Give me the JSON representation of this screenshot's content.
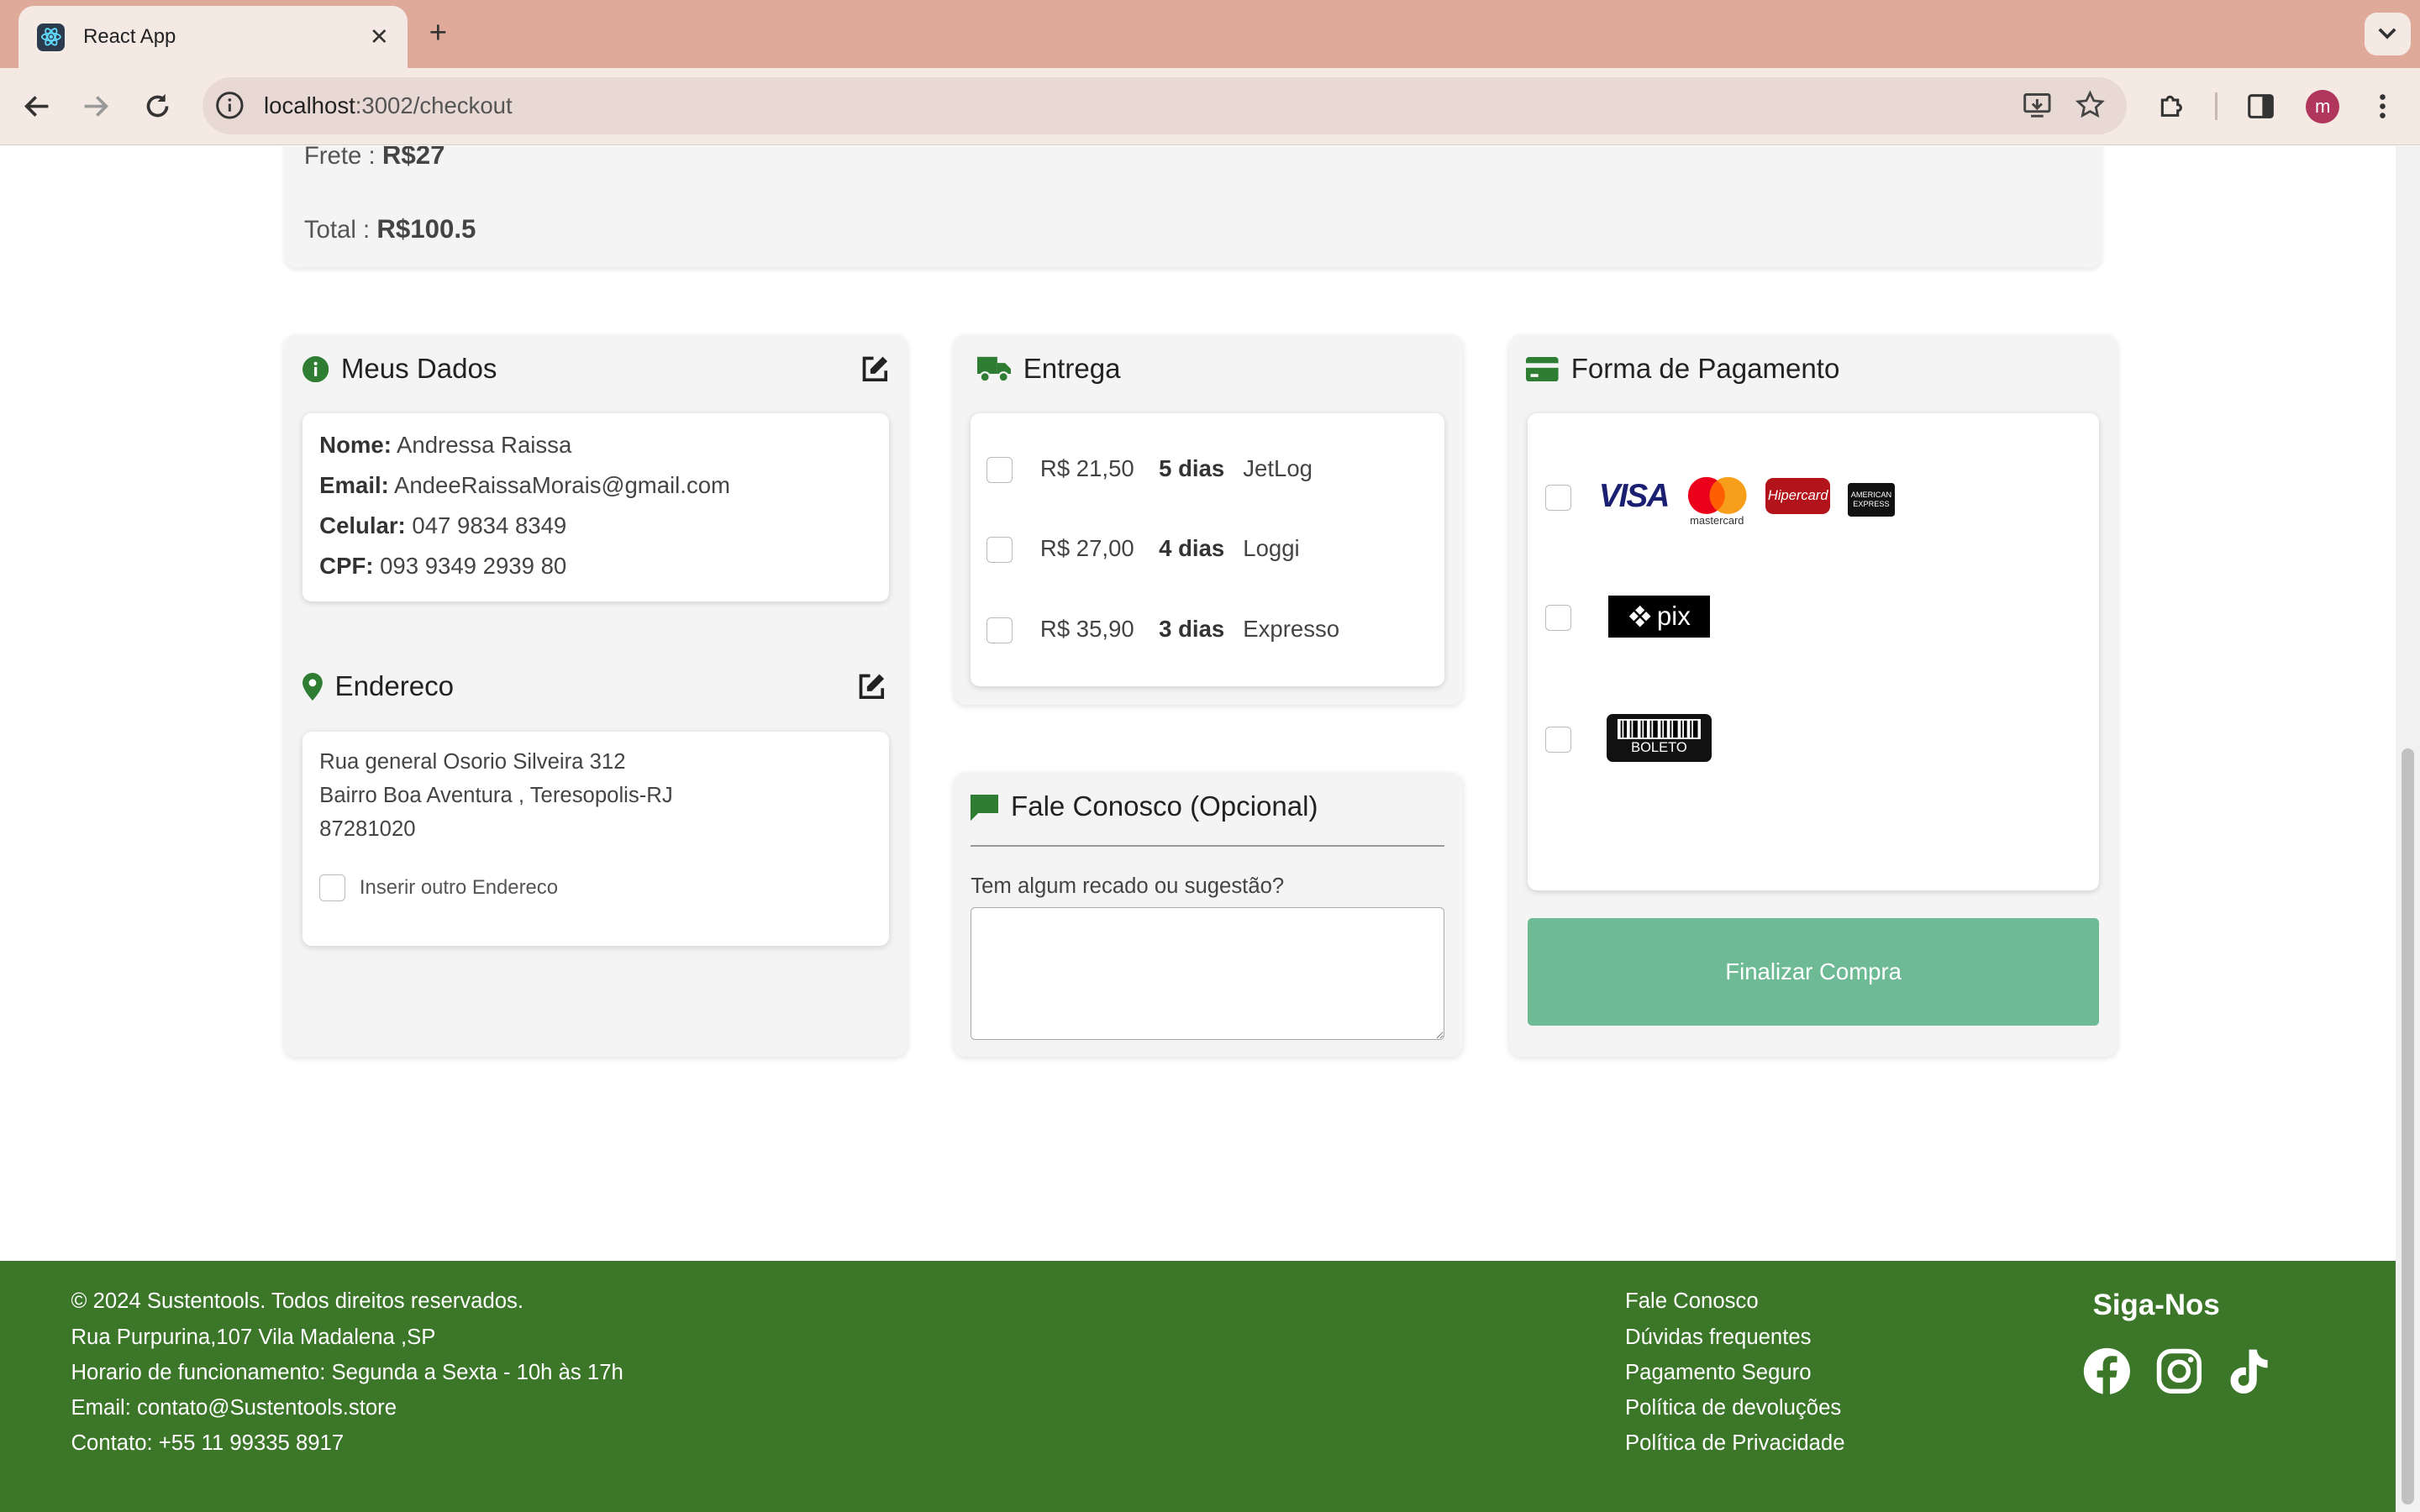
{
  "browser": {
    "tab_title": "React App",
    "url_host": "localhost",
    "url_path": ":3002/checkout",
    "profile_initial": "m"
  },
  "summary": {
    "frete_label": "Frete : ",
    "frete_value": "R$27",
    "total_label": "Total : ",
    "total_value": "R$100.5"
  },
  "meus_dados": {
    "title": "Meus Dados",
    "nome_label": "Nome:",
    "nome": "Andressa Raissa",
    "email_label": "Email:",
    "email": "AndeeRaissaMorais@gmail.com",
    "celular_label": "Celular:",
    "celular": "047 9834 8349",
    "cpf_label": "CPF:",
    "cpf": "093 9349 2939 80"
  },
  "endereco": {
    "title": "Endereco",
    "line1": "Rua general Osorio Silveira 312",
    "line2": "Bairro Boa Aventura , Teresopolis-RJ",
    "line3": "87281020",
    "outro_label": "Inserir outro Endereco"
  },
  "entrega": {
    "title": "Entrega",
    "options": [
      {
        "price": "R$ 21,50",
        "days": "5 dias",
        "carrier": "JetLog"
      },
      {
        "price": "R$ 27,00",
        "days": "4 dias",
        "carrier": "Loggi"
      },
      {
        "price": "R$ 35,90",
        "days": "3 dias",
        "carrier": "Expresso"
      }
    ]
  },
  "fale": {
    "title": "Fale Conosco (Opcional)",
    "prompt": "Tem algum recado ou sugestão?",
    "message": ""
  },
  "pagamento": {
    "title": "Forma de Pagamento",
    "visa": "VISA",
    "mastercard": "mastercard",
    "hipercard": "Hipercard",
    "amex_1": "AMERICAN",
    "amex_2": "EXPRESS",
    "pix": "pix",
    "boleto": "BOLETO",
    "submit": "Finalizar Compra",
    "accent": "#6dba95"
  },
  "footer": {
    "copyright": "© 2024 Sustentools. Todos direitos reservados.",
    "address": "Rua Purpurina,107 Vila Madalena ,SP",
    "hours": "Horario de funcionamento: Segunda a Sexta - 10h às 17h",
    "email": "Email: contato@Sustentools.store",
    "contact": "Contato: +55 11 99335 8917",
    "links": [
      "Fale Conosco",
      "Dúvidas frequentes",
      "Pagamento Seguro",
      "Política de devoluções",
      "Política de Privacidade"
    ],
    "follow": "Siga-Nos",
    "background": "#3b7629"
  }
}
